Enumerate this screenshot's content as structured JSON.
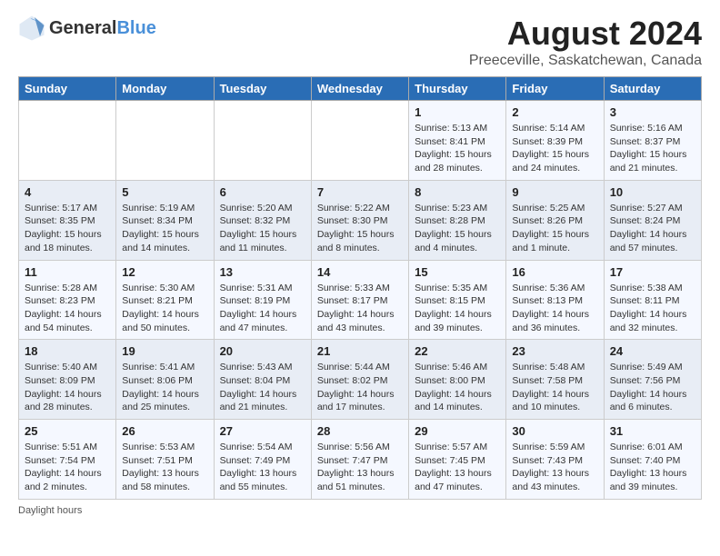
{
  "header": {
    "logo_general": "General",
    "logo_blue": "Blue",
    "title": "August 2024",
    "subtitle": "Preeceville, Saskatchewan, Canada"
  },
  "days_of_week": [
    "Sunday",
    "Monday",
    "Tuesday",
    "Wednesday",
    "Thursday",
    "Friday",
    "Saturday"
  ],
  "weeks": [
    {
      "days": [
        {
          "number": "",
          "info": ""
        },
        {
          "number": "",
          "info": ""
        },
        {
          "number": "",
          "info": ""
        },
        {
          "number": "",
          "info": ""
        },
        {
          "number": "1",
          "info": "Sunrise: 5:13 AM\nSunset: 8:41 PM\nDaylight: 15 hours and 28 minutes."
        },
        {
          "number": "2",
          "info": "Sunrise: 5:14 AM\nSunset: 8:39 PM\nDaylight: 15 hours and 24 minutes."
        },
        {
          "number": "3",
          "info": "Sunrise: 5:16 AM\nSunset: 8:37 PM\nDaylight: 15 hours and 21 minutes."
        }
      ]
    },
    {
      "days": [
        {
          "number": "4",
          "info": "Sunrise: 5:17 AM\nSunset: 8:35 PM\nDaylight: 15 hours and 18 minutes."
        },
        {
          "number": "5",
          "info": "Sunrise: 5:19 AM\nSunset: 8:34 PM\nDaylight: 15 hours and 14 minutes."
        },
        {
          "number": "6",
          "info": "Sunrise: 5:20 AM\nSunset: 8:32 PM\nDaylight: 15 hours and 11 minutes."
        },
        {
          "number": "7",
          "info": "Sunrise: 5:22 AM\nSunset: 8:30 PM\nDaylight: 15 hours and 8 minutes."
        },
        {
          "number": "8",
          "info": "Sunrise: 5:23 AM\nSunset: 8:28 PM\nDaylight: 15 hours and 4 minutes."
        },
        {
          "number": "9",
          "info": "Sunrise: 5:25 AM\nSunset: 8:26 PM\nDaylight: 15 hours and 1 minute."
        },
        {
          "number": "10",
          "info": "Sunrise: 5:27 AM\nSunset: 8:24 PM\nDaylight: 14 hours and 57 minutes."
        }
      ]
    },
    {
      "days": [
        {
          "number": "11",
          "info": "Sunrise: 5:28 AM\nSunset: 8:23 PM\nDaylight: 14 hours and 54 minutes."
        },
        {
          "number": "12",
          "info": "Sunrise: 5:30 AM\nSunset: 8:21 PM\nDaylight: 14 hours and 50 minutes."
        },
        {
          "number": "13",
          "info": "Sunrise: 5:31 AM\nSunset: 8:19 PM\nDaylight: 14 hours and 47 minutes."
        },
        {
          "number": "14",
          "info": "Sunrise: 5:33 AM\nSunset: 8:17 PM\nDaylight: 14 hours and 43 minutes."
        },
        {
          "number": "15",
          "info": "Sunrise: 5:35 AM\nSunset: 8:15 PM\nDaylight: 14 hours and 39 minutes."
        },
        {
          "number": "16",
          "info": "Sunrise: 5:36 AM\nSunset: 8:13 PM\nDaylight: 14 hours and 36 minutes."
        },
        {
          "number": "17",
          "info": "Sunrise: 5:38 AM\nSunset: 8:11 PM\nDaylight: 14 hours and 32 minutes."
        }
      ]
    },
    {
      "days": [
        {
          "number": "18",
          "info": "Sunrise: 5:40 AM\nSunset: 8:09 PM\nDaylight: 14 hours and 28 minutes."
        },
        {
          "number": "19",
          "info": "Sunrise: 5:41 AM\nSunset: 8:06 PM\nDaylight: 14 hours and 25 minutes."
        },
        {
          "number": "20",
          "info": "Sunrise: 5:43 AM\nSunset: 8:04 PM\nDaylight: 14 hours and 21 minutes."
        },
        {
          "number": "21",
          "info": "Sunrise: 5:44 AM\nSunset: 8:02 PM\nDaylight: 14 hours and 17 minutes."
        },
        {
          "number": "22",
          "info": "Sunrise: 5:46 AM\nSunset: 8:00 PM\nDaylight: 14 hours and 14 minutes."
        },
        {
          "number": "23",
          "info": "Sunrise: 5:48 AM\nSunset: 7:58 PM\nDaylight: 14 hours and 10 minutes."
        },
        {
          "number": "24",
          "info": "Sunrise: 5:49 AM\nSunset: 7:56 PM\nDaylight: 14 hours and 6 minutes."
        }
      ]
    },
    {
      "days": [
        {
          "number": "25",
          "info": "Sunrise: 5:51 AM\nSunset: 7:54 PM\nDaylight: 14 hours and 2 minutes."
        },
        {
          "number": "26",
          "info": "Sunrise: 5:53 AM\nSunset: 7:51 PM\nDaylight: 13 hours and 58 minutes."
        },
        {
          "number": "27",
          "info": "Sunrise: 5:54 AM\nSunset: 7:49 PM\nDaylight: 13 hours and 55 minutes."
        },
        {
          "number": "28",
          "info": "Sunrise: 5:56 AM\nSunset: 7:47 PM\nDaylight: 13 hours and 51 minutes."
        },
        {
          "number": "29",
          "info": "Sunrise: 5:57 AM\nSunset: 7:45 PM\nDaylight: 13 hours and 47 minutes."
        },
        {
          "number": "30",
          "info": "Sunrise: 5:59 AM\nSunset: 7:43 PM\nDaylight: 13 hours and 43 minutes."
        },
        {
          "number": "31",
          "info": "Sunrise: 6:01 AM\nSunset: 7:40 PM\nDaylight: 13 hours and 39 minutes."
        }
      ]
    }
  ],
  "footer": {
    "note": "Daylight hours"
  }
}
